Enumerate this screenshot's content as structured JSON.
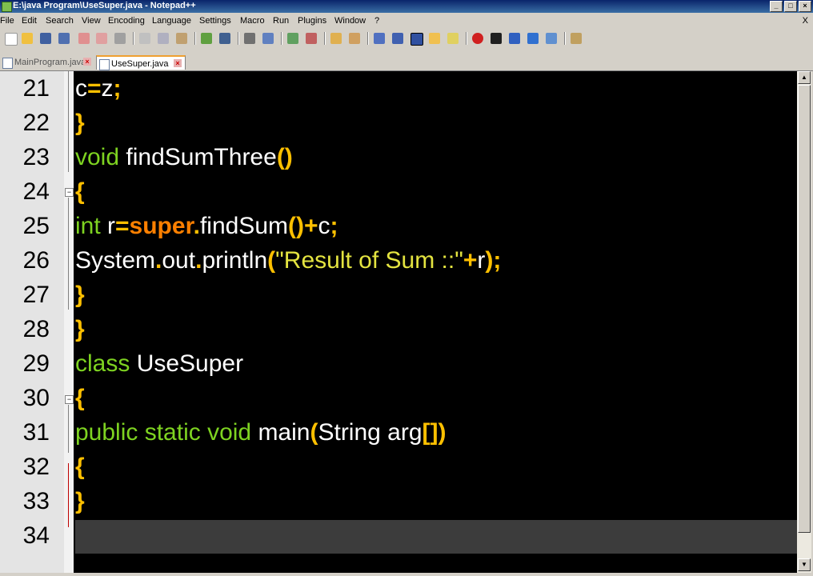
{
  "window": {
    "title": "E:\\java Program\\UseSuper.java - Notepad++",
    "controls": [
      "_",
      "□",
      "×"
    ]
  },
  "menu": {
    "items": [
      "File",
      "Edit",
      "Search",
      "View",
      "Encoding",
      "Language",
      "Settings",
      "Macro",
      "Run",
      "Plugins",
      "Window",
      "?"
    ],
    "close_label": "X"
  },
  "toolbar": {
    "icons": [
      "new-file-icon",
      "open-file-icon",
      "save-icon",
      "save-all-icon",
      "close-icon",
      "close-all-icon",
      "print-icon",
      "cut-icon",
      "copy-icon",
      "paste-icon",
      "undo-icon",
      "redo-icon",
      "find-icon",
      "replace-icon",
      "zoom-in-icon",
      "zoom-out-icon",
      "sync-vertical-icon",
      "sync-horizontal-icon",
      "word-wrap-icon",
      "show-all-chars-icon",
      "indent-guide-icon",
      "folder-icon",
      "doc-map-icon",
      "record-macro-icon",
      "stop-record-icon",
      "play-macro-icon",
      "run-macro-multiple-icon",
      "save-macro-icon",
      "plugin-icon"
    ]
  },
  "tabs": [
    {
      "label": "MainProgram.java",
      "active": false,
      "close": "×"
    },
    {
      "label": "UseSuper.java",
      "active": true,
      "close": "×"
    }
  ],
  "editor": {
    "lines": [
      {
        "num": "21",
        "tokens": [
          [
            "c",
            "txt"
          ],
          [
            "=",
            "op"
          ],
          [
            "z",
            "txt"
          ],
          [
            ";",
            "op"
          ]
        ]
      },
      {
        "num": "22",
        "tokens": [
          [
            "}",
            "op"
          ]
        ]
      },
      {
        "num": "23",
        "tokens": [
          [
            "void",
            "kw"
          ],
          [
            " findSumThree",
            "txt"
          ],
          [
            "()",
            "op"
          ]
        ]
      },
      {
        "num": "24",
        "tokens": [
          [
            "{",
            "op"
          ]
        ]
      },
      {
        "num": "25",
        "tokens": [
          [
            "int",
            "kw"
          ],
          [
            " r",
            "txt"
          ],
          [
            "=",
            "op"
          ],
          [
            "super",
            "sup"
          ],
          [
            ".",
            "op"
          ],
          [
            "findSum",
            "txt"
          ],
          [
            "()",
            "op"
          ],
          [
            "+",
            "op"
          ],
          [
            "c",
            "txt"
          ],
          [
            ";",
            "op"
          ]
        ]
      },
      {
        "num": "26",
        "tokens": [
          [
            "System",
            "txt"
          ],
          [
            ".",
            "op"
          ],
          [
            "out",
            "txt"
          ],
          [
            ".",
            "op"
          ],
          [
            "println",
            "txt"
          ],
          [
            "(",
            "op"
          ],
          [
            "\"Result of Sum ::\"",
            "str"
          ],
          [
            "+",
            "op"
          ],
          [
            "r",
            "txt"
          ],
          [
            ");",
            "op"
          ]
        ]
      },
      {
        "num": "27",
        "tokens": [
          [
            "}",
            "op"
          ]
        ]
      },
      {
        "num": "28",
        "tokens": [
          [
            "}",
            "op"
          ]
        ]
      },
      {
        "num": "29",
        "tokens": [
          [
            "class",
            "kw"
          ],
          [
            " UseSuper",
            "txt"
          ]
        ]
      },
      {
        "num": "30",
        "tokens": [
          [
            "{",
            "op"
          ]
        ]
      },
      {
        "num": "31",
        "tokens": [
          [
            "public static void",
            "kw"
          ],
          [
            " main",
            "txt"
          ],
          [
            "(",
            "op"
          ],
          [
            "String arg",
            "txt"
          ],
          [
            "[]",
            "op"
          ],
          [
            ")",
            "op"
          ]
        ]
      },
      {
        "num": "32",
        "tokens": [
          [
            "{",
            "op"
          ]
        ]
      },
      {
        "num": "33",
        "tokens": [
          [
            "}",
            "op"
          ]
        ]
      },
      {
        "num": "34",
        "tokens": []
      }
    ]
  },
  "colors": {
    "keyword": "#7ed321",
    "operator": "#ffc000",
    "super": "#ff8000",
    "string": "#e4e440",
    "text": "#ffffff",
    "background": "#000000"
  }
}
